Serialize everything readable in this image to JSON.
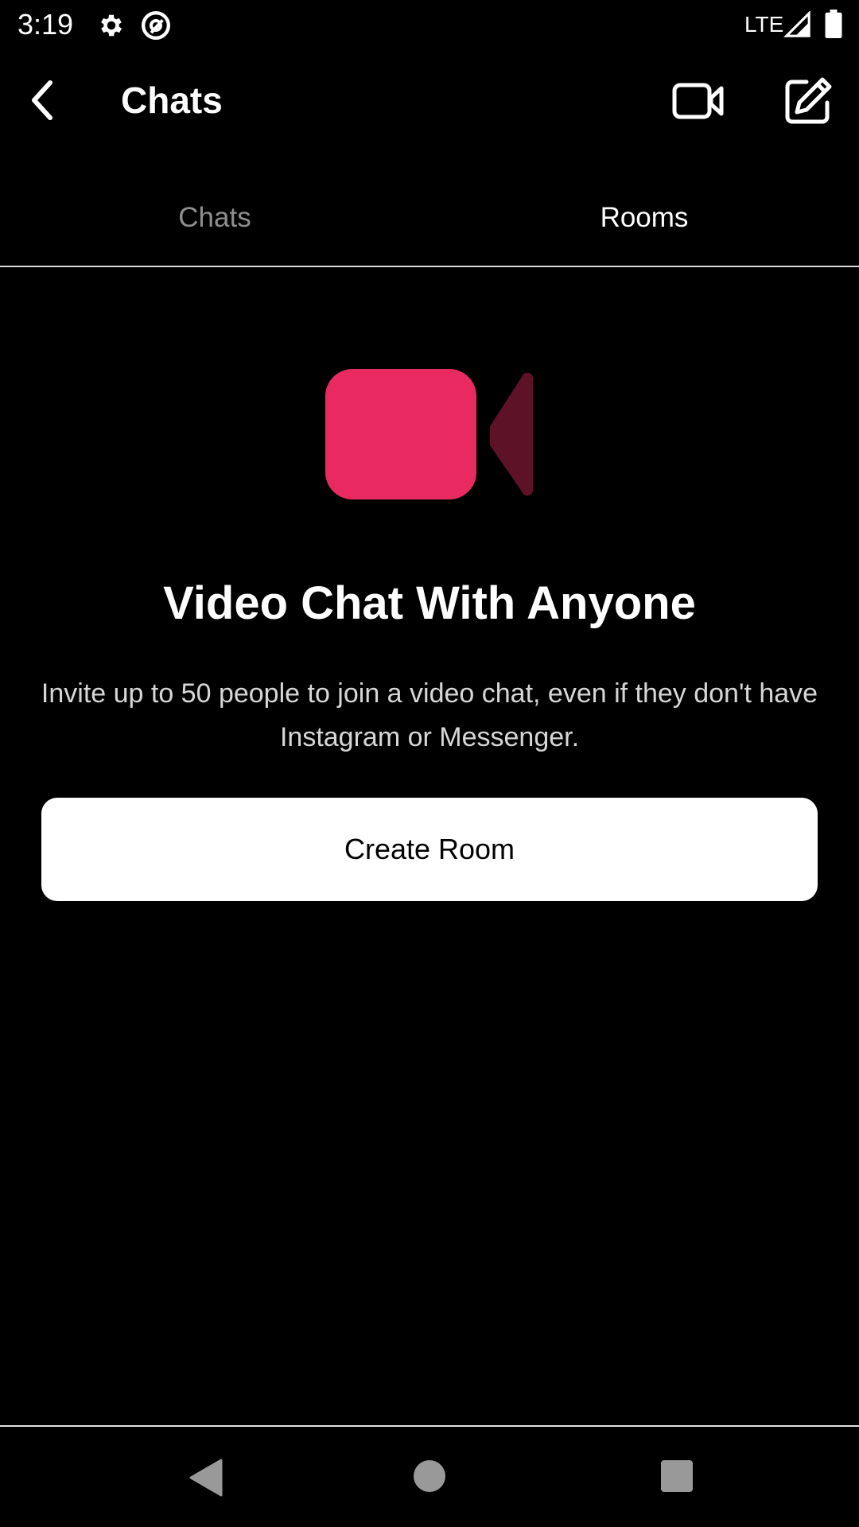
{
  "status_bar": {
    "time": "3:19",
    "network": "LTE",
    "icons": [
      "gear-icon",
      "at-sign-icon",
      "signal-icon",
      "battery-icon"
    ]
  },
  "header": {
    "title": "Chats",
    "icons": [
      "chevron-left-icon",
      "video-camera-icon",
      "compose-icon"
    ]
  },
  "tabs": [
    {
      "label": "Chats",
      "selected": false
    },
    {
      "label": "Rooms",
      "selected": true
    }
  ],
  "empty_state": {
    "icon": "video-camera-icon",
    "title": "Video Chat With Anyone",
    "description": "Invite up to 50 people to join a video chat, even if they don't have Instagram or Messenger.",
    "button_label": "Create Room"
  },
  "colors": {
    "accent": "#E82A61",
    "accent_dark": "#5E1228",
    "background": "#000000",
    "tab_inactive": "#8E8E8E"
  },
  "nav_bar": {
    "icons": [
      "nav-back-icon",
      "nav-home-icon",
      "nav-recents-icon"
    ]
  }
}
